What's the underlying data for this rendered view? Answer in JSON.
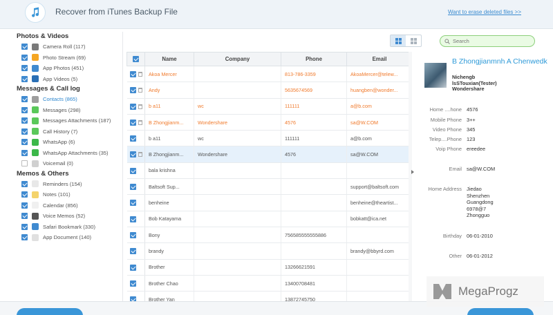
{
  "header": {
    "title": "Recover from iTunes Backup File",
    "erase_link": "Want to erase deleted files >>"
  },
  "sidebar": {
    "categories": [
      {
        "title": "Photos & Videos",
        "items": [
          {
            "label": "Camera Roll (117)",
            "icon": "camera-roll-icon",
            "color": "#7a7a7a",
            "checked": true
          },
          {
            "label": "Photo Stream (69)",
            "icon": "photo-stream-icon",
            "color": "#f5a623",
            "checked": true
          },
          {
            "label": "App Photos (451)",
            "icon": "app-photos-icon",
            "color": "#3f8ad0",
            "checked": true
          },
          {
            "label": "App Videos (5)",
            "icon": "app-videos-icon",
            "color": "#2a6fb5",
            "checked": true
          }
        ]
      },
      {
        "title": "Messages & Call log",
        "items": [
          {
            "label": "Contacts (865)",
            "icon": "contacts-icon",
            "color": "#9e9e9e",
            "checked": true,
            "active": true
          },
          {
            "label": "Messages (298)",
            "icon": "messages-icon",
            "color": "#5ac85a",
            "checked": true
          },
          {
            "label": "Messages Attachments (187)",
            "icon": "attachments-icon",
            "color": "#5ac85a",
            "checked": true
          },
          {
            "label": "Call History (7)",
            "icon": "call-history-icon",
            "color": "#5ac85a",
            "checked": true
          },
          {
            "label": "WhatsApp (6)",
            "icon": "whatsapp-icon",
            "color": "#3cb84a",
            "checked": true
          },
          {
            "label": "WhatsApp Attachments (35)",
            "icon": "whatsapp-attachments-icon",
            "color": "#3cb84a",
            "checked": true
          },
          {
            "label": "Voicemail (0)",
            "icon": "voicemail-icon",
            "color": "#d0d0d0",
            "checked": false
          }
        ]
      },
      {
        "title": "Memos & Others",
        "items": [
          {
            "label": "Reminders (154)",
            "icon": "reminders-icon",
            "color": "#e8e8e8",
            "checked": true
          },
          {
            "label": "Notes (101)",
            "icon": "notes-icon",
            "color": "#f4d36b",
            "checked": true
          },
          {
            "label": "Calendar (856)",
            "icon": "calendar-icon",
            "color": "#f0f0f0",
            "checked": true
          },
          {
            "label": "Voice Memos (52)",
            "icon": "voice-memos-icon",
            "color": "#555555",
            "checked": true
          },
          {
            "label": "Safari Bookmark (330)",
            "icon": "safari-icon",
            "color": "#3f8ad0",
            "checked": true
          },
          {
            "label": "App Document (140)",
            "icon": "app-document-icon",
            "color": "#e0e0e0",
            "checked": true
          }
        ]
      }
    ]
  },
  "search": {
    "placeholder": "Search",
    "value": ""
  },
  "table": {
    "columns": [
      "Name",
      "Company",
      "Phone",
      "Email"
    ],
    "rows": [
      {
        "name": "Akoa Mercer",
        "company": "",
        "phone": "813-786-3359",
        "email": "AkoaMercer@telew...",
        "deleted": true
      },
      {
        "name": "Andy",
        "company": "",
        "phone": "5635674569",
        "email": "huangben@wonder...",
        "deleted": true
      },
      {
        "name": "b a11",
        "company": "wc",
        "phone": "111111",
        "email": "a@b.com",
        "deleted": true
      },
      {
        "name": "B Zhongjianm...",
        "company": "Wondershare",
        "phone": "4576",
        "email": "sa@W.COM",
        "deleted": true
      },
      {
        "name": "b a11",
        "company": "wc",
        "phone": "111111",
        "email": "a@b.com",
        "deleted": false
      },
      {
        "name": "B Zhongjianm...",
        "company": "Wondershare",
        "phone": "4576",
        "email": "sa@W.COM",
        "deleted": false,
        "selected": true
      },
      {
        "name": "bala krishna",
        "company": "",
        "phone": "",
        "email": "",
        "deleted": false
      },
      {
        "name": "Baltsoft Sup...",
        "company": "",
        "phone": "",
        "email": "support@baltsoft.com",
        "deleted": false
      },
      {
        "name": "benheine",
        "company": "",
        "phone": "",
        "email": "benheine@theartist...",
        "deleted": false
      },
      {
        "name": "Bob Katayama",
        "company": "",
        "phone": "",
        "email": "bobkatt@ica.net",
        "deleted": false
      },
      {
        "name": "Bony",
        "company": "",
        "phone": "756585555555886",
        "email": "",
        "deleted": false
      },
      {
        "name": "brandy",
        "company": "",
        "phone": "",
        "email": "brandy@bbyrd.com",
        "deleted": false
      },
      {
        "name": "Brother",
        "company": "",
        "phone": "13266621591",
        "email": "",
        "deleted": false
      },
      {
        "name": "Brother Chao",
        "company": "",
        "phone": "13400708481",
        "email": "",
        "deleted": false
      },
      {
        "name": "Brother Yan",
        "company": "",
        "phone": "13872745750",
        "email": "",
        "deleted": false
      }
    ]
  },
  "detail": {
    "name": "B Zhongjianmnh A Chenwedk",
    "sub": [
      "Nichengb",
      "lsSTouxian(Tester)",
      "Wondershare"
    ],
    "fields": [
      {
        "label": "Home ....hone",
        "value": "4576"
      },
      {
        "label": "Mobile Phone",
        "value": "3++"
      },
      {
        "label": "Video Phone",
        "value": "345"
      },
      {
        "label": "Telep....Phone",
        "value": "123"
      },
      {
        "label": "Voip Phone",
        "value": "ereedee"
      },
      {
        "label": "Email",
        "value": "sa@W.COM"
      },
      {
        "label": "Home Address",
        "value": [
          "Jiedao",
          "Shenzhen",
          "Guangdong",
          "6978@7",
          "Zhongguo"
        ]
      },
      {
        "label": "Birthday",
        "value": "06-01-2010"
      },
      {
        "label": "Other",
        "value": "06-01-2012"
      }
    ]
  },
  "watermark": {
    "text": "MegaProgz"
  }
}
